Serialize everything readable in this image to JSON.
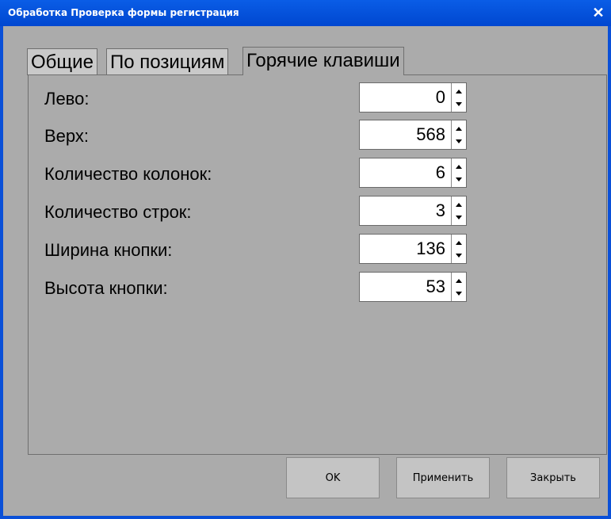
{
  "window": {
    "title": "Обработка  Проверка формы регистрация",
    "close_glyph": "✕"
  },
  "tabs": [
    {
      "label": "Общие"
    },
    {
      "label": "По позициям"
    },
    {
      "label": "Горячие клавиши"
    }
  ],
  "fields": [
    {
      "label": "Лево:",
      "value": "0"
    },
    {
      "label": "Верх:",
      "value": "568"
    },
    {
      "label": "Количество колонок:",
      "value": "6"
    },
    {
      "label": "Количество строк:",
      "value": "3"
    },
    {
      "label": "Ширина кнопки:",
      "value": "136"
    },
    {
      "label": "Высота кнопки:",
      "value": "53"
    }
  ],
  "buttons": {
    "ok": "OK",
    "apply": "Применить",
    "close": "Закрыть"
  },
  "colors": {
    "title_bar": "#0a50d8",
    "client": "#ababab"
  }
}
